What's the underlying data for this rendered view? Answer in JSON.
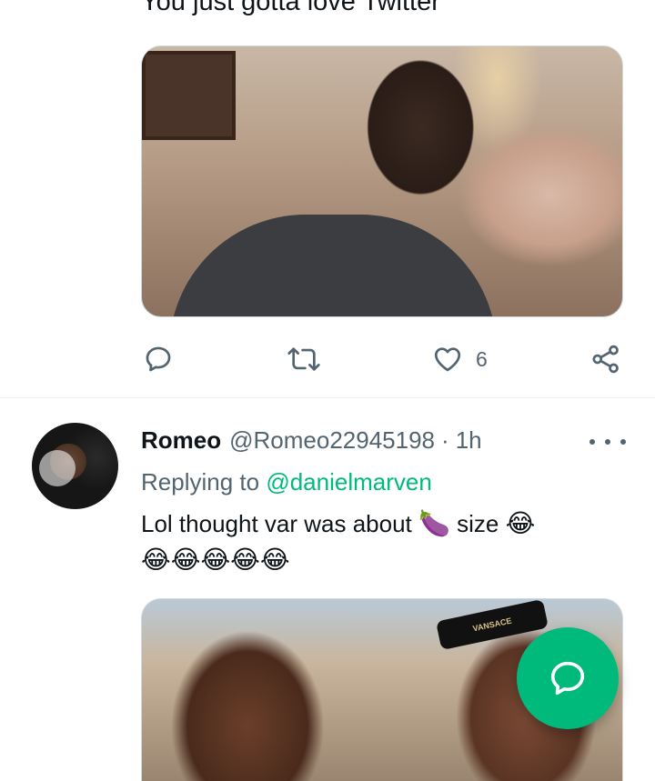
{
  "tweet_top": {
    "text": "You just gotta love Twitter",
    "media_alt": "",
    "actions": {
      "reply_icon": "reply-icon",
      "retweet_icon": "retweet-icon",
      "like_icon": "heart-icon",
      "like_count": "6",
      "share_icon": "share-icon"
    }
  },
  "tweet_reply": {
    "author_name": "Romeo",
    "handle": "@Romeo22945198",
    "separator": "·",
    "time": "1h",
    "more_icon": "more-icon",
    "replying_prefix": "Replying to",
    "replying_to": "@danielmarven",
    "text_part1": "Lol thought var was about",
    "emoji_eggplant": "🍆",
    "text_part2": "size",
    "emoji_laugh_1": "😂",
    "emoji_laugh_row": [
      "😂",
      "😂",
      "😂",
      "😂",
      "😂"
    ],
    "media_text": "VANSACE"
  },
  "fab": {
    "icon": "compose-reply-icon"
  },
  "colors": {
    "accent": "#00ba7c",
    "secondary_text": "#536471",
    "primary_text": "#0f1419",
    "divider": "#eff3f4"
  }
}
